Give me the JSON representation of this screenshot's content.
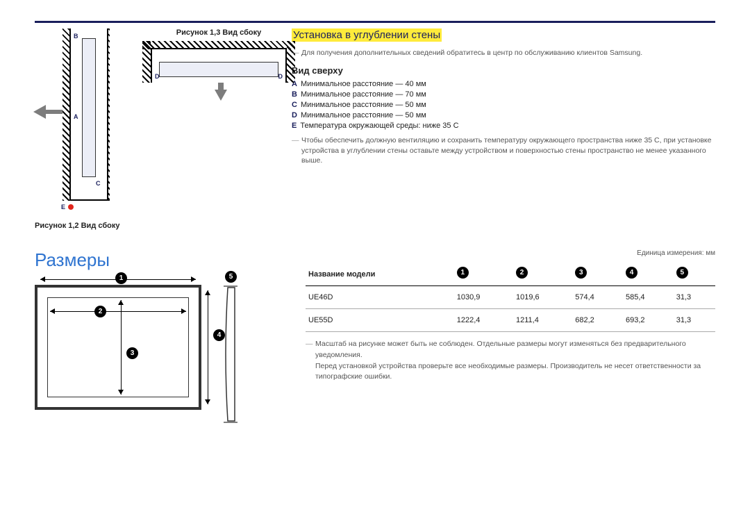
{
  "captions": {
    "fig13": "Рисунок 1,3 Вид сбоку",
    "fig12": "Рисунок 1,2 Вид сбоку"
  },
  "labels": {
    "A": "A",
    "B": "B",
    "C": "C",
    "D": "D",
    "E": "E"
  },
  "section": {
    "title": "Установка в углублении стены",
    "note": "Для получения дополнительных сведений обратитесь в центр по обслуживанию клиентов Samsung.",
    "sub": "Вид сверху",
    "specA": "Минимальное расстояние — 40 мм",
    "specB": "Минимальное расстояние — 70 мм",
    "specC": "Минимальное расстояние — 50 мм",
    "specD": "Минимальное расстояние — 50 мм",
    "specE": "Температура окружающей среды: ниже 35 C",
    "warn": "Чтобы обеспечить должную вентиляцию и сохранить температуру окружающего пространства ниже 35 C, при установке устройства в углублении стены оставьте между устройством и поверхностью стены пространство не менее указанного выше."
  },
  "dimensions": {
    "title": "Размеры",
    "unit": "Единица измерения: мм",
    "header_model": "Название модели",
    "rows": [
      {
        "model": "UE46D",
        "c1": "1030,9",
        "c2": "1019,6",
        "c3": "574,4",
        "c4": "585,4",
        "c5": "31,3"
      },
      {
        "model": "UE55D",
        "c1": "1222,4",
        "c2": "1211,4",
        "c3": "682,2",
        "c4": "693,2",
        "c5": "31,3"
      }
    ],
    "foot1": "Масштаб на рисунке может быть не соблюден. Отдельные размеры могут изменяться без предварительного уведомления.",
    "foot2": "Перед установкой устройства проверьте все необходимые размеры. Производитель не несет ответственности за типографские ошибки."
  },
  "nums": {
    "n1": "1",
    "n2": "2",
    "n3": "3",
    "n4": "4",
    "n5": "5"
  }
}
